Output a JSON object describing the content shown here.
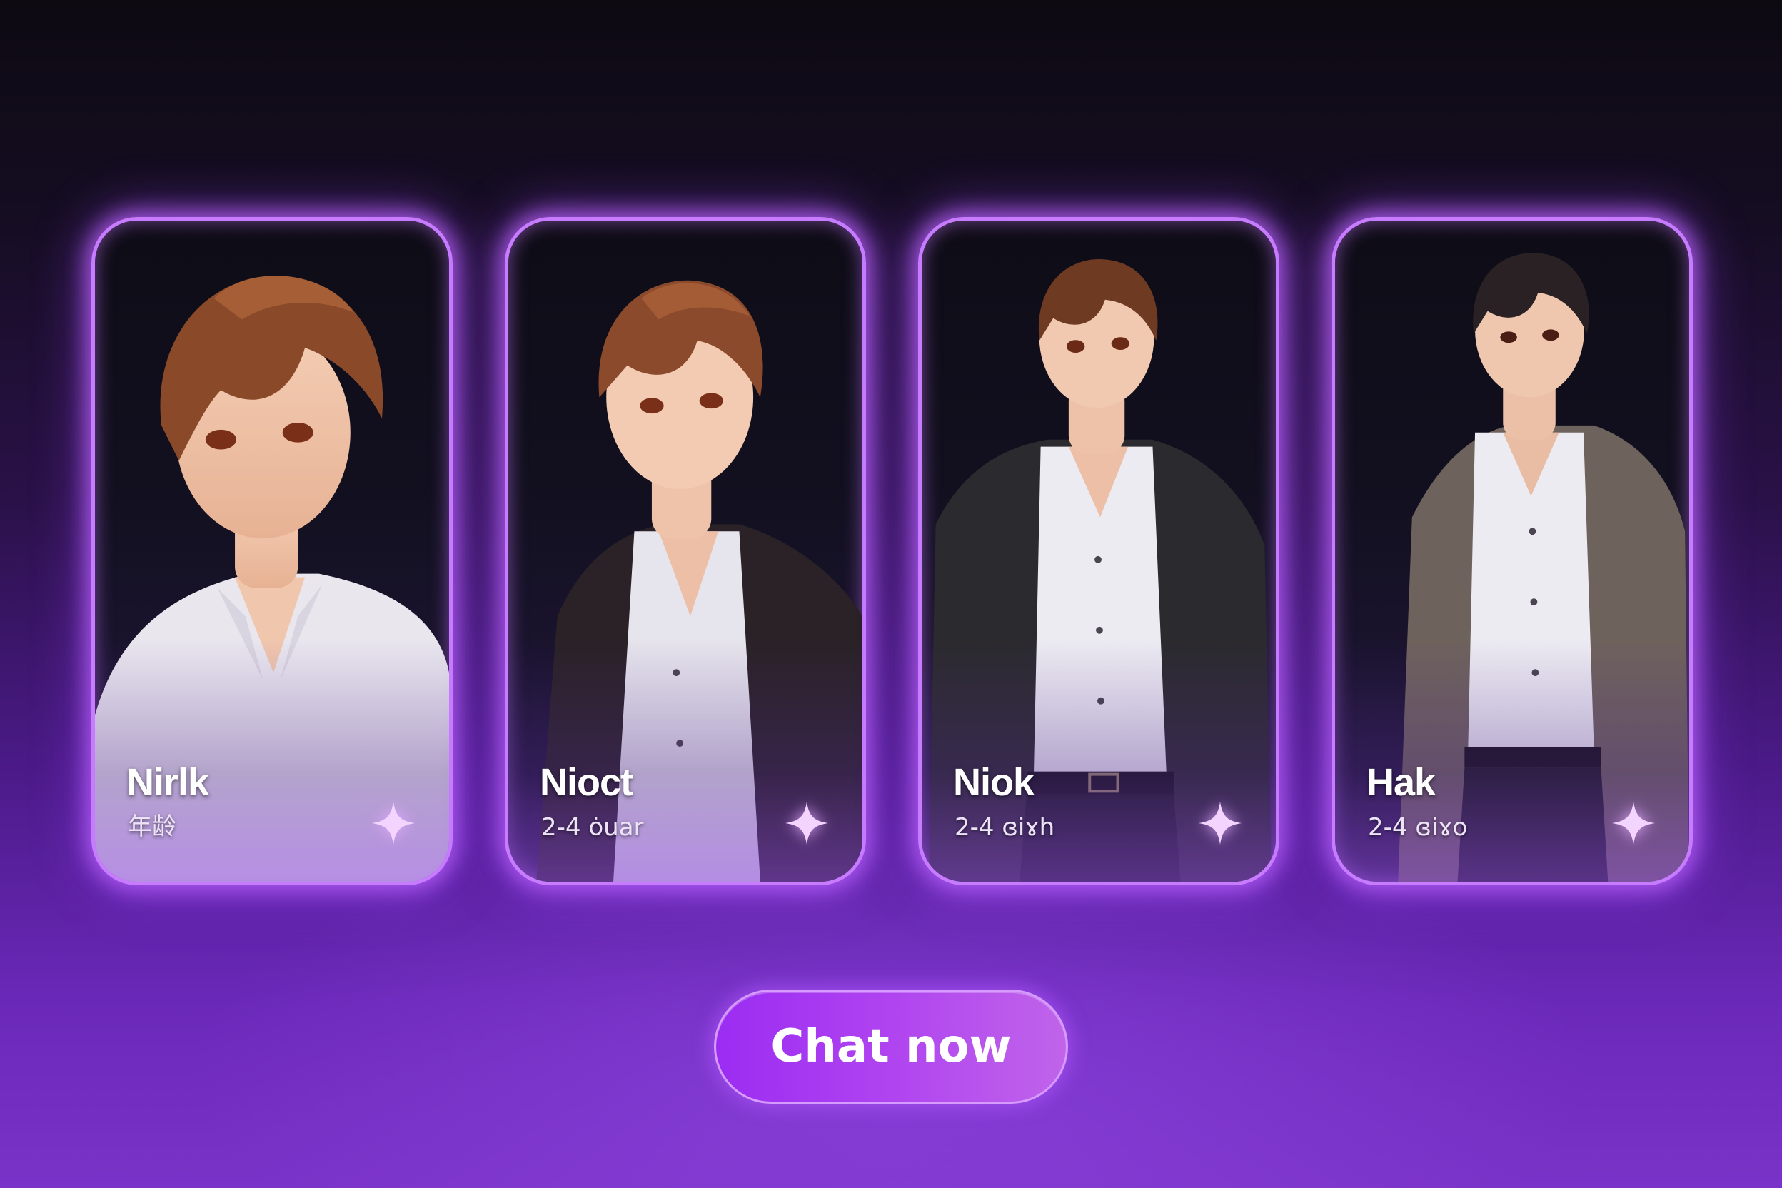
{
  "colors": {
    "card_glow": "#c77bff",
    "button_gradient_start": "#9b2cf2",
    "button_gradient_end": "#c064ea",
    "background_top": "#0d0a12",
    "background_bottom": "#7a33c8"
  },
  "cards": [
    {
      "name": "Nirlk",
      "age": "年龄",
      "icon": "sparkle-icon",
      "hair": "#8a4a2a",
      "jacket": "none"
    },
    {
      "name": "Nioct",
      "age": "2-4 ȯuar",
      "icon": "sparkle-icon",
      "hair": "#8b4a2b",
      "jacket": "#2a2226"
    },
    {
      "name": "Niok",
      "age": "2-4 ɞiɤh",
      "icon": "sparkle-icon",
      "hair": "#6e3a22",
      "jacket": "#2b2a2e"
    },
    {
      "name": "Hak",
      "age": "2-4 ɞiɤo",
      "icon": "sparkle-icon",
      "hair": "#2a2124",
      "jacket": "#6e625c"
    }
  ],
  "cta": {
    "label": "Chat now"
  }
}
